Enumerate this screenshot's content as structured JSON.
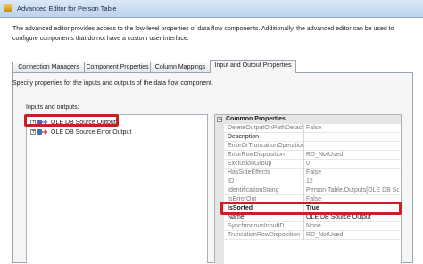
{
  "window": {
    "title": "Advanced Editor for Person Table"
  },
  "description": "The advanced editor provides access to the low-level properties of data flow components. Additionally, the advanced editor can be used to configure components that do not have a custom user interface.",
  "tabs": [
    {
      "label": "Connection Managers"
    },
    {
      "label": "Component Properties"
    },
    {
      "label": "Column Mappings"
    },
    {
      "label": "Input and Output Properties"
    }
  ],
  "active_tab": "Input and Output Properties",
  "panel": {
    "description": "Specify properties for the inputs and outputs of the data flow component.",
    "io_label": "Inputs and outputs:",
    "tree": [
      {
        "label": "OLE DB Source Output",
        "expander": "+",
        "highlighted": true
      },
      {
        "label": "OLE DB Source Error Output",
        "expander": "+",
        "highlighted": false
      }
    ]
  },
  "properties": {
    "category": "Common Properties",
    "category_toggle": "−",
    "rows": [
      {
        "name": "DeleteOutputOnPathDetach",
        "value": "False",
        "editable": false
      },
      {
        "name": "Description",
        "value": "",
        "editable": true
      },
      {
        "name": "ErrorOrTruncationOperation",
        "value": "",
        "editable": false
      },
      {
        "name": "ErrorRowDisposition",
        "value": "RD_NotUsed",
        "editable": false
      },
      {
        "name": "ExclusionGroup",
        "value": "0",
        "editable": false
      },
      {
        "name": "HasSideEffects",
        "value": "False",
        "editable": false
      },
      {
        "name": "ID",
        "value": "12",
        "editable": false
      },
      {
        "name": "IdentificationString",
        "value": "Person Table.Outputs[OLE DB Source",
        "editable": false
      },
      {
        "name": "IsErrorOut",
        "value": "False",
        "editable": false
      },
      {
        "name": "IsSorted",
        "value": "True",
        "editable": true,
        "highlighted": true
      },
      {
        "name": "Name",
        "value": "OLE DB Source Output",
        "editable": true
      },
      {
        "name": "SynchronousInputID",
        "value": "None",
        "editable": false
      },
      {
        "name": "TruncationRowDisposition",
        "value": "RD_NotUsed",
        "editable": false
      }
    ]
  },
  "colors": {
    "highlight": "#cc1f25",
    "titlebar": "#c8dbf0",
    "grid_header": "#e6e6e6"
  }
}
